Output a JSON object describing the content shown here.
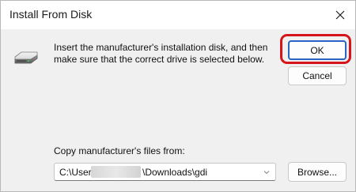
{
  "window": {
    "title": "Install From Disk"
  },
  "message": "Insert the manufacturer's installation disk, and then make sure that the correct drive is selected below.",
  "buttons": {
    "ok_label": "OK",
    "cancel_label": "Cancel",
    "browse_label": "Browse..."
  },
  "copy_section": {
    "label": "Copy manufacturer's files from:",
    "path_prefix": "C:\\Users",
    "path_suffix": "\\Downloads\\gdi"
  },
  "icons": {
    "close": "close-icon",
    "disk": "disk-drive-icon",
    "dropdown": "chevron-down-icon"
  },
  "colors": {
    "highlight_ring": "#d6141b",
    "default_button_border": "#2b62c4"
  }
}
